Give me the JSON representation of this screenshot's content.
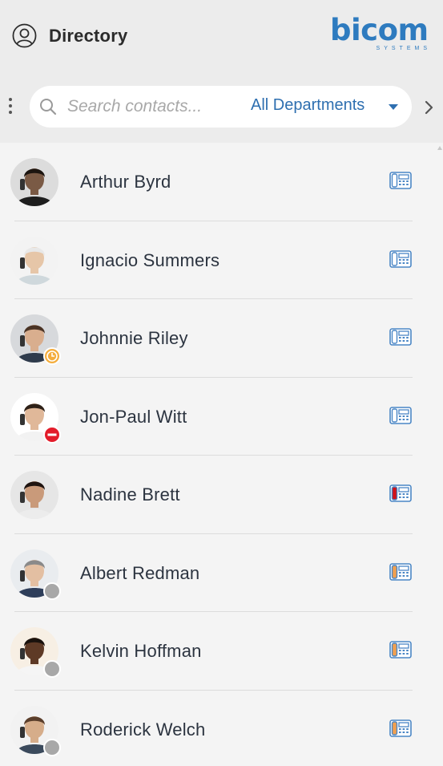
{
  "header": {
    "title": "Directory",
    "user_icon": "user-circle-icon",
    "logo": {
      "word": "bicom",
      "sub": "SYSTEMS",
      "color": "#2e7bbf"
    }
  },
  "toolbar": {
    "menu_icon": "kebab-menu-icon",
    "search": {
      "placeholder": "Search contacts...",
      "value": "",
      "icon": "search-icon"
    },
    "department": {
      "selected": "All Departments",
      "icon": "caret-down-icon"
    },
    "next_icon": "chevron-right-icon"
  },
  "status_colors": {
    "away": "#f4ad3d",
    "dnd": "#e31c2a",
    "offline": "#a8a8a8",
    "phone_idle": "#4a86c5",
    "phone_busy": "#d0121a",
    "phone_ringing": "#f0a050"
  },
  "contacts": [
    {
      "name": "Arthur Byrd",
      "status": "none",
      "phone_state": "idle",
      "skin": "#7a5a45",
      "hair": "#1c1510",
      "shirt": "#1e1e1e",
      "bg": "#dcdcdc"
    },
    {
      "name": "Ignacio Summers",
      "status": "none",
      "phone_state": "idle",
      "skin": "#e6c6a8",
      "hair": "#e8e8e8",
      "shirt": "#cfd8dc",
      "bg": "#f3f3f3"
    },
    {
      "name": "Johnnie Riley",
      "status": "away",
      "phone_state": "idle",
      "skin": "#d9ae8e",
      "hair": "#4a3325",
      "shirt": "#2f3b4c",
      "bg": "#d7d9dc"
    },
    {
      "name": "Jon-Paul Witt",
      "status": "dnd",
      "phone_state": "idle",
      "skin": "#e0b899",
      "hair": "#2e2118",
      "shirt": "#f2f2f2",
      "bg": "#ffffff"
    },
    {
      "name": "Nadine Brett",
      "status": "none",
      "phone_state": "busy",
      "skin": "#c99a7a",
      "hair": "#1f1410",
      "shirt": "#ececec",
      "bg": "#e6e6e6"
    },
    {
      "name": "Albert Redman",
      "status": "offline",
      "phone_state": "ringing",
      "skin": "#e3bfa2",
      "hair": "#8a8a8a",
      "shirt": "#2e3e5a",
      "bg": "#e9ecef"
    },
    {
      "name": "Kelvin Hoffman",
      "status": "offline",
      "phone_state": "ringing",
      "skin": "#5e3a26",
      "hair": "#1a120d",
      "shirt": "#f5f5f5",
      "bg": "#f7efe4"
    },
    {
      "name": "Roderick Welch",
      "status": "offline",
      "phone_state": "ringing",
      "skin": "#d6ad8a",
      "hair": "#5a3e2b",
      "shirt": "#3b4a5c",
      "bg": "#f2f2f2"
    }
  ]
}
